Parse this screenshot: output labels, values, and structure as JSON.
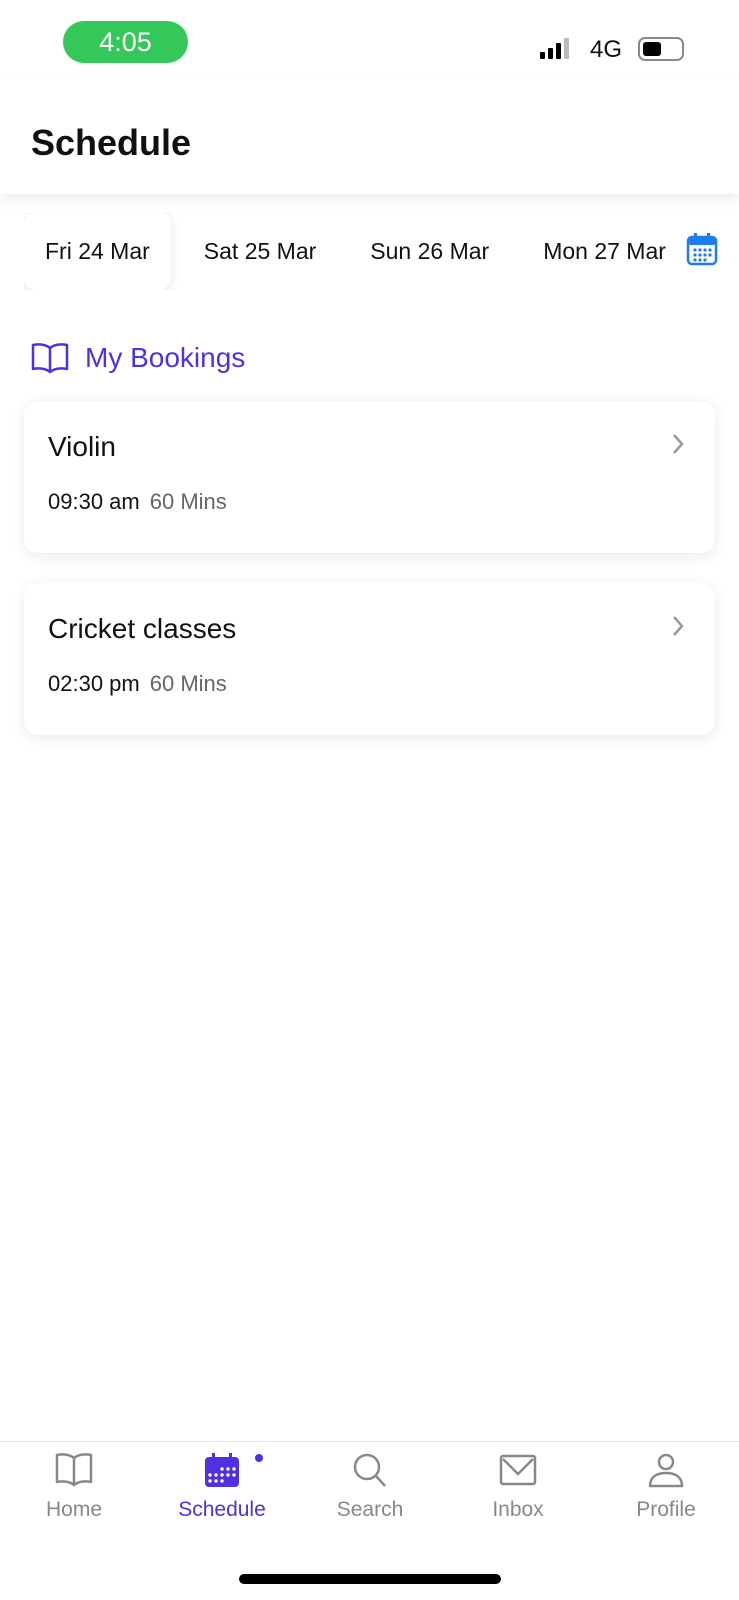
{
  "status_bar": {
    "time": "4:05",
    "network": "4G"
  },
  "header": {
    "title": "Schedule"
  },
  "dates": [
    {
      "label": "Fri 24 Mar",
      "selected": true
    },
    {
      "label": "Sat 25 Mar"
    },
    {
      "label": "Sun 26 Mar"
    },
    {
      "label": "Mon 27 Mar"
    }
  ],
  "section": {
    "title": "My Bookings",
    "icon": "book-open-icon"
  },
  "bookings": [
    {
      "title": "Violin",
      "time": "09:30 am",
      "duration": "60 Mins"
    },
    {
      "title": "Cricket classes",
      "time": "02:30 pm",
      "duration": "60 Mins"
    }
  ],
  "tabs": [
    {
      "label": "Home",
      "icon": "book-icon"
    },
    {
      "label": "Schedule",
      "icon": "calendar-icon",
      "active": true
    },
    {
      "label": "Search",
      "icon": "search-icon"
    },
    {
      "label": "Inbox",
      "icon": "mail-icon"
    },
    {
      "label": "Profile",
      "icon": "user-icon"
    }
  ],
  "colors": {
    "accent": "#5030e0",
    "calendar": "#1e7bf0",
    "time_pill": "#34c759"
  }
}
